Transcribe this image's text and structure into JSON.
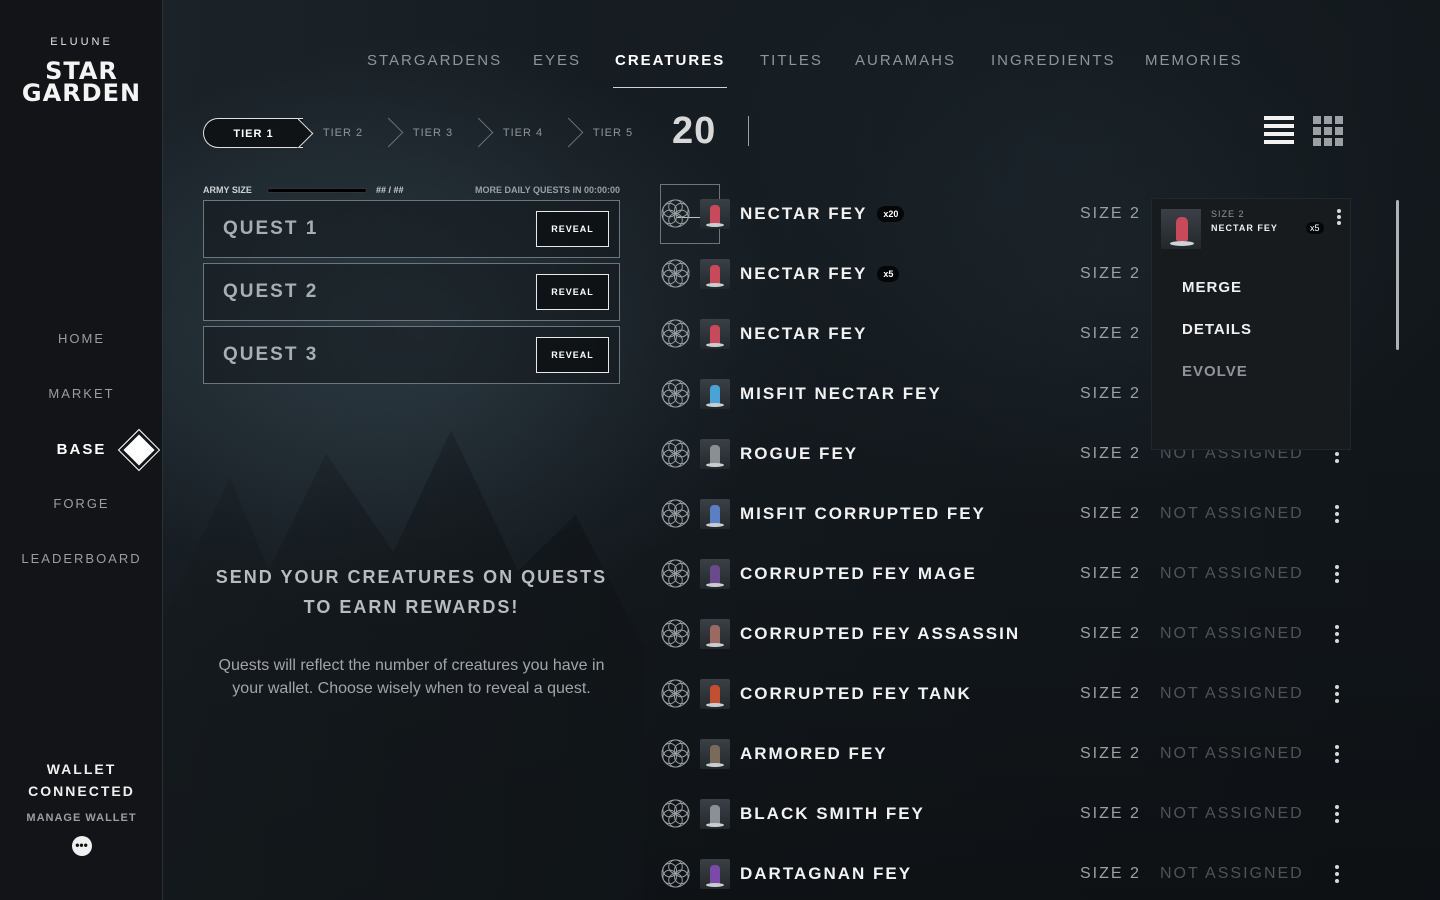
{
  "brand": {
    "pre": "",
    "name": "ELUUNE",
    "title_line1": "STAR",
    "title_line2": "GARDEN"
  },
  "nav": [
    {
      "label": "HOME",
      "active": false
    },
    {
      "label": "MARKET",
      "active": false
    },
    {
      "label": "BASE",
      "active": true
    },
    {
      "label": "FORGE",
      "active": false
    },
    {
      "label": "LEADERBOARD",
      "active": false
    }
  ],
  "wallet": {
    "status_line1": "WALLET",
    "status_line2": "CONNECTED",
    "manage": "MANAGE WALLET",
    "menu_glyph": "•••"
  },
  "tabs": [
    "STARGARDENS",
    "EYES",
    "CREATURES",
    "TITLES",
    "AURAMAHS",
    "INGREDIENTS",
    "MEMORIES"
  ],
  "active_tab": "CREATURES",
  "tiers": [
    "TIER 1",
    "TIER 2",
    "TIER 3",
    "TIER 4",
    "TIER 5"
  ],
  "active_tier": "TIER 1",
  "creature_count": "20",
  "army": {
    "label": "ARMY SIZE",
    "ratio": "## / ##",
    "more_quests": "MORE DAILY QUESTS IN 00:00:00"
  },
  "quests": [
    {
      "name": "QUEST 1",
      "action": "REVEAL"
    },
    {
      "name": "QUEST 2",
      "action": "REVEAL"
    },
    {
      "name": "QUEST 3",
      "action": "REVEAL"
    }
  ],
  "promo": {
    "headline": "SEND YOUR CREATURES ON QUESTS TO EARN REWARDS!",
    "body": "Quests will reflect the number of creatures you have in your wallet. Choose wisely when to reveal a quest."
  },
  "creatures": [
    {
      "name": "NECTAR FEY",
      "badge": "x20",
      "size": "SIZE 2",
      "assignment": "",
      "fig_color": "#c64a5a"
    },
    {
      "name": "NECTAR FEY",
      "badge": "x5",
      "size": "SIZE 2",
      "assignment": "",
      "fig_color": "#c64a5a"
    },
    {
      "name": "NECTAR FEY",
      "badge": "",
      "size": "SIZE 2",
      "assignment": "",
      "fig_color": "#c64a5a"
    },
    {
      "name": "MISFIT NECTAR FEY",
      "badge": "",
      "size": "SIZE 2",
      "assignment": "",
      "fig_color": "#4aa3d6"
    },
    {
      "name": "ROGUE FEY",
      "badge": "",
      "size": "SIZE 2",
      "assignment": "NOT ASSIGNED",
      "fig_color": "#8a8f94"
    },
    {
      "name": "MISFIT CORRUPTED FEY",
      "badge": "",
      "size": "SIZE 2",
      "assignment": "NOT ASSIGNED",
      "fig_color": "#5b7fc2"
    },
    {
      "name": "CORRUPTED FEY MAGE",
      "badge": "",
      "size": "SIZE 2",
      "assignment": "NOT ASSIGNED",
      "fig_color": "#6a4a8a"
    },
    {
      "name": "CORRUPTED FEY ASSASSIN",
      "badge": "",
      "size": "SIZE 2",
      "assignment": "NOT ASSIGNED",
      "fig_color": "#9a6a62"
    },
    {
      "name": "CORRUPTED FEY TANK",
      "badge": "",
      "size": "SIZE 2",
      "assignment": "NOT ASSIGNED",
      "fig_color": "#c0502f"
    },
    {
      "name": "ARMORED FEY",
      "badge": "",
      "size": "SIZE 2",
      "assignment": "NOT ASSIGNED",
      "fig_color": "#7a6a5a"
    },
    {
      "name": "BLACK SMITH FEY",
      "badge": "",
      "size": "SIZE 2",
      "assignment": "NOT ASSIGNED",
      "fig_color": "#8c9096"
    },
    {
      "name": "DARTAGNAN FEY",
      "badge": "",
      "size": "SIZE 2",
      "assignment": "NOT ASSIGNED",
      "fig_color": "#7a4aa8"
    }
  ],
  "popup": {
    "size": "SIZE 2",
    "name": "NECTAR FEY",
    "badge": "x5",
    "menu": [
      {
        "label": "MERGE",
        "dim": false
      },
      {
        "label": "DETAILS",
        "dim": false
      },
      {
        "label": "EVOLVE",
        "dim": true
      }
    ]
  },
  "icons": {
    "view_list": "list-view-icon",
    "view_grid": "grid-view-icon",
    "row_symbol": "flower-of-life-icon",
    "kebab": "vertical-dots-icon",
    "nav_active_marker": "diamond-icon"
  }
}
